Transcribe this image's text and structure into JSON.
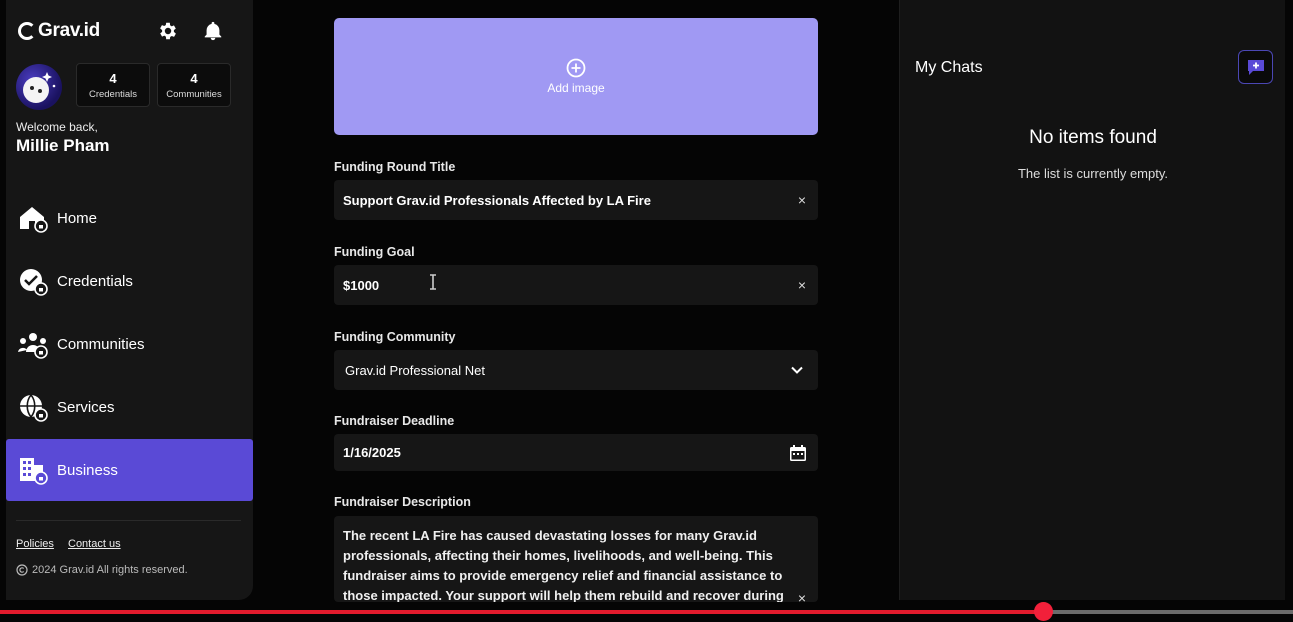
{
  "brand": {
    "name": "Grav.id"
  },
  "profile": {
    "welcome": "Welcome back,",
    "name": "Millie Pham",
    "stats": [
      {
        "value": "4",
        "label": "Credentials"
      },
      {
        "value": "4",
        "label": "Communities"
      }
    ]
  },
  "nav": {
    "items": [
      {
        "label": "Home",
        "icon": "home-icon"
      },
      {
        "label": "Credentials",
        "icon": "credential-check-icon"
      },
      {
        "label": "Communities",
        "icon": "communities-icon"
      },
      {
        "label": "Services",
        "icon": "globe-icon"
      },
      {
        "label": "Business",
        "icon": "building-icon",
        "active": true
      }
    ]
  },
  "footer": {
    "links": [
      "Policies",
      "Contact us"
    ],
    "copyright": "2024 Grav.id  All rights reserved."
  },
  "form": {
    "add_image_label": "Add image",
    "title_label": "Funding Round Title",
    "title_value": "Support Grav.id Professionals Affected by LA Fire",
    "goal_label": "Funding Goal",
    "goal_value": "$1000",
    "community_label": "Funding Community",
    "community_value": "Grav.id Professional Net",
    "deadline_label": "Fundraiser Deadline",
    "deadline_value": "1/16/2025",
    "description_label": "Fundraiser Description",
    "description_value": "The recent LA Fire has caused devastating losses for many Grav.id professionals, affecting their homes, livelihoods, and well-being. This fundraiser aims to provide emergency relief and financial assistance to those impacted. Your support will help them rebuild and recover during",
    "clear_symbol": "×"
  },
  "chats": {
    "title": "My Chats",
    "empty_title": "No items found",
    "empty_subtitle": "The list is currently empty."
  },
  "video": {
    "progress_fraction": 0.807
  },
  "colors": {
    "accent": "#5a4ad6",
    "add_image_bg": "#a099f3",
    "progress": "#e31b2d"
  }
}
